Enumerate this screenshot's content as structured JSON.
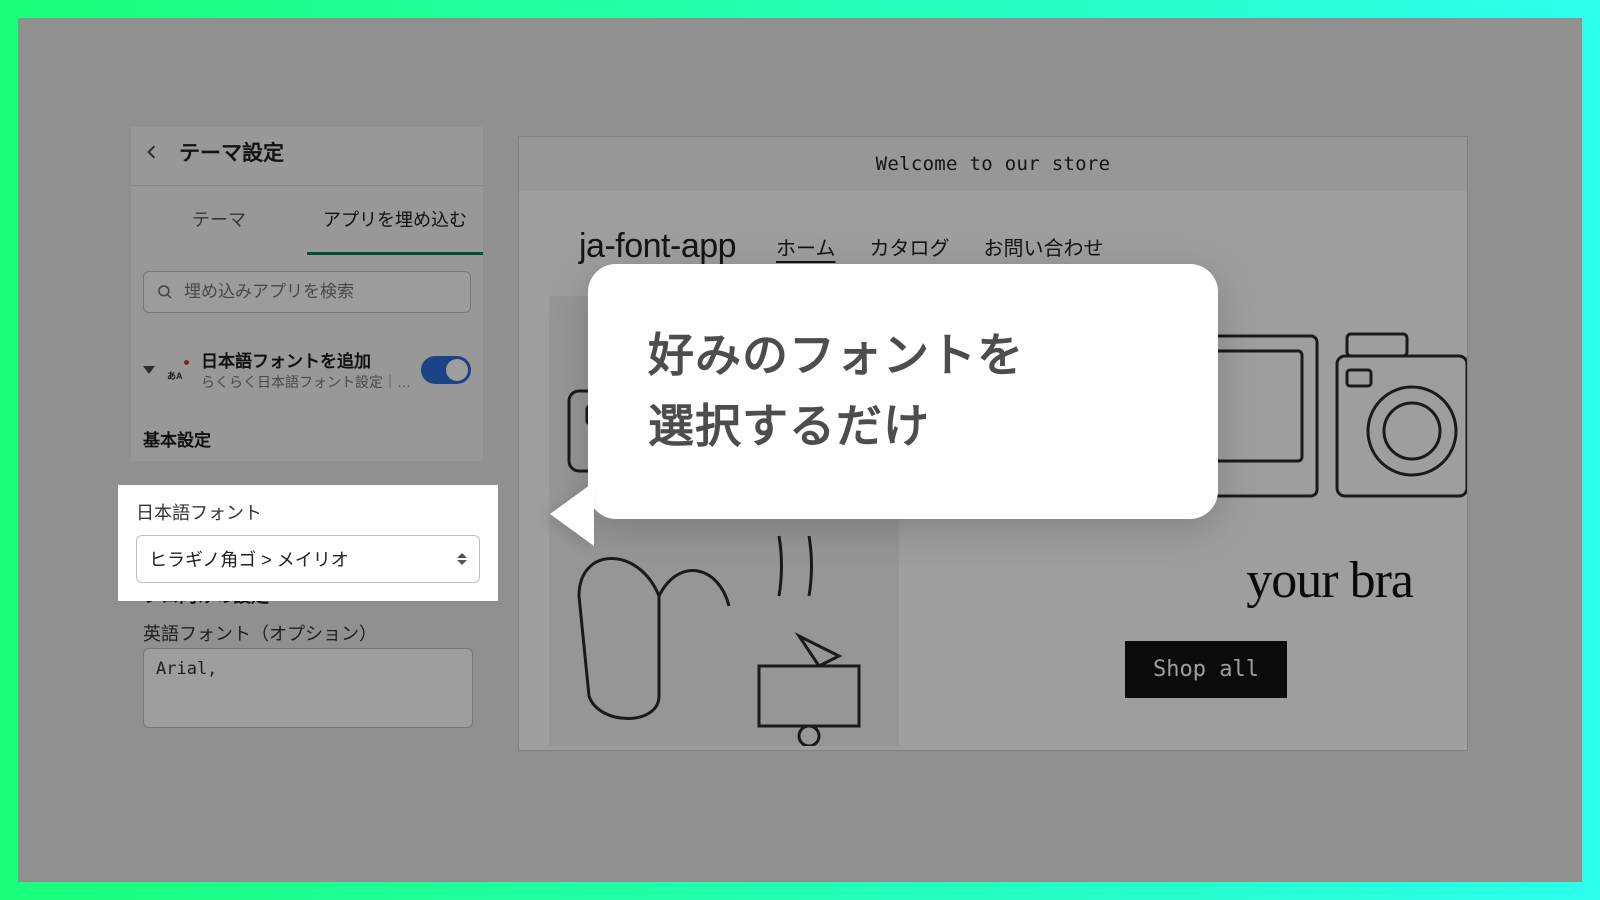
{
  "sidebar": {
    "title": "テーマ設定",
    "tabs": {
      "theme": "テーマ",
      "embed": "アプリを埋め込む"
    },
    "search_placeholder": "埋め込みアプリを検索",
    "app": {
      "title": "日本語フォントを追加",
      "subtitle": "らくらく日本語フォント設定｜…"
    },
    "basic_label": "基本設定",
    "font_label": "日本語フォント",
    "font_value": "ヒラギノ角ゴ > メイリオ",
    "pro_label": "プロ向けの設定",
    "en_label": "英語フォント（オプション）",
    "en_value": "Arial,"
  },
  "preview": {
    "announcement": "Welcome to our store",
    "brand": "ja-font-app",
    "nav": {
      "home": "ホーム",
      "catalog": "カタログ",
      "contact": "お問い合わせ"
    },
    "hero_text": "your bra",
    "cta": "Shop all"
  },
  "tooltip": {
    "line1": "好みのフォントを",
    "line2": "選択するだけ"
  }
}
